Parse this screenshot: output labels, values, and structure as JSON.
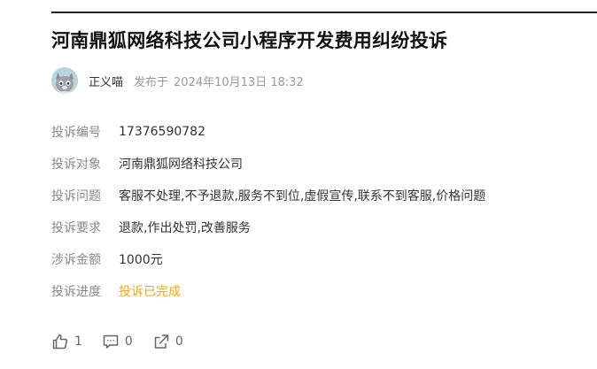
{
  "article": {
    "title": "河南鼎狐网络科技公司小程序开发费用纠纷投诉",
    "author": "正义喵",
    "publish_prefix": "发布于",
    "publish_time": "2024年10月13日 18:32"
  },
  "complaint": {
    "rows": [
      {
        "label": "投诉编号",
        "value": "17376590782"
      },
      {
        "label": "投诉对象",
        "value": "河南鼎狐网络科技公司"
      },
      {
        "label": "投诉问题",
        "value": "客服不处理,不予退款,服务不到位,虚假宣传,联系不到客服,价格问题"
      },
      {
        "label": "投诉要求",
        "value": "退款,作出处罚,改善服务"
      },
      {
        "label": "涉诉金额",
        "value": "1000元"
      },
      {
        "label": "投诉进度",
        "value": "投诉已完成"
      }
    ],
    "status_color": "#f5a623"
  },
  "actions": {
    "like_count": "1",
    "comment_count": "0",
    "share_count": "0",
    "like_icon": "thumbs-up-icon",
    "comment_icon": "comment-icon",
    "share_icon": "share-icon"
  }
}
